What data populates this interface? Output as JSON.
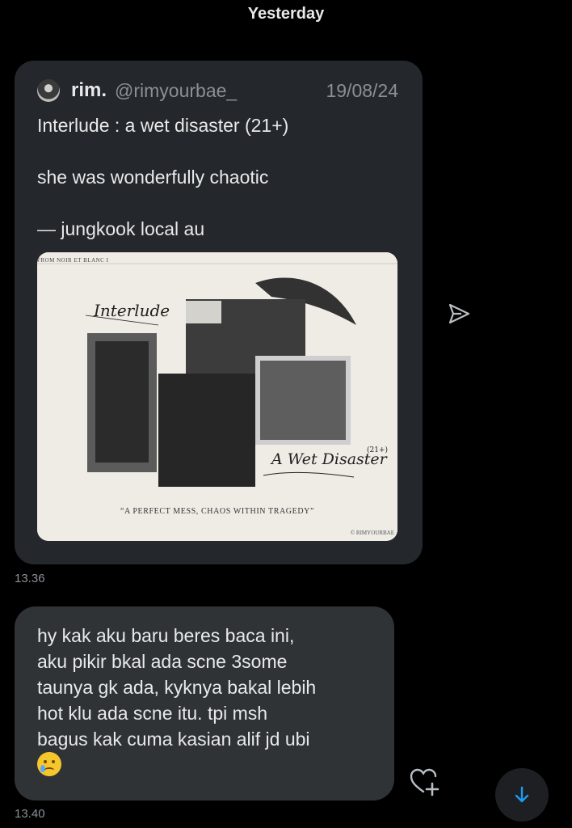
{
  "date_separator": "Yesterday",
  "quoted_post": {
    "author_name": "rim.",
    "author_handle": "@rimyourbae_",
    "date": "19/08/24",
    "text": "Interlude : a wet disaster (21+)\n\nshe was wonderfully chaotic\n\n— jungkook local au",
    "media": {
      "top_label": "FROM NOIR ET BLANC I",
      "title_script": "Interlude",
      "subtitle_script": "A Wet Disaster",
      "rating": "(21+)",
      "caption": "“A PERFECT MESS, CHAOS WITHIN TRAGEDY”",
      "credit": "© RIMYOURBAE"
    }
  },
  "messages": [
    {
      "time": "13.36"
    },
    {
      "text": "hy kak aku baru beres baca ini,\naku pikir bkal ada scne 3some\ntaunya gk ada, kyknya bakal lebih\nhot klu ada scne itu. tpi msh\nbagus kak cuma kasian alif jd ubi",
      "emoji": "crying-face",
      "time": "13.40"
    }
  ],
  "icons": {
    "share": "share-icon",
    "react": "heart-plus-icon",
    "scroll": "arrow-down-icon"
  },
  "colors": {
    "background": "#000000",
    "bubble": "#2f3336",
    "quote_bubble": "#24272b",
    "text": "#e7e9ea",
    "muted": "#8b9096",
    "accent": "#1d9bf0"
  }
}
